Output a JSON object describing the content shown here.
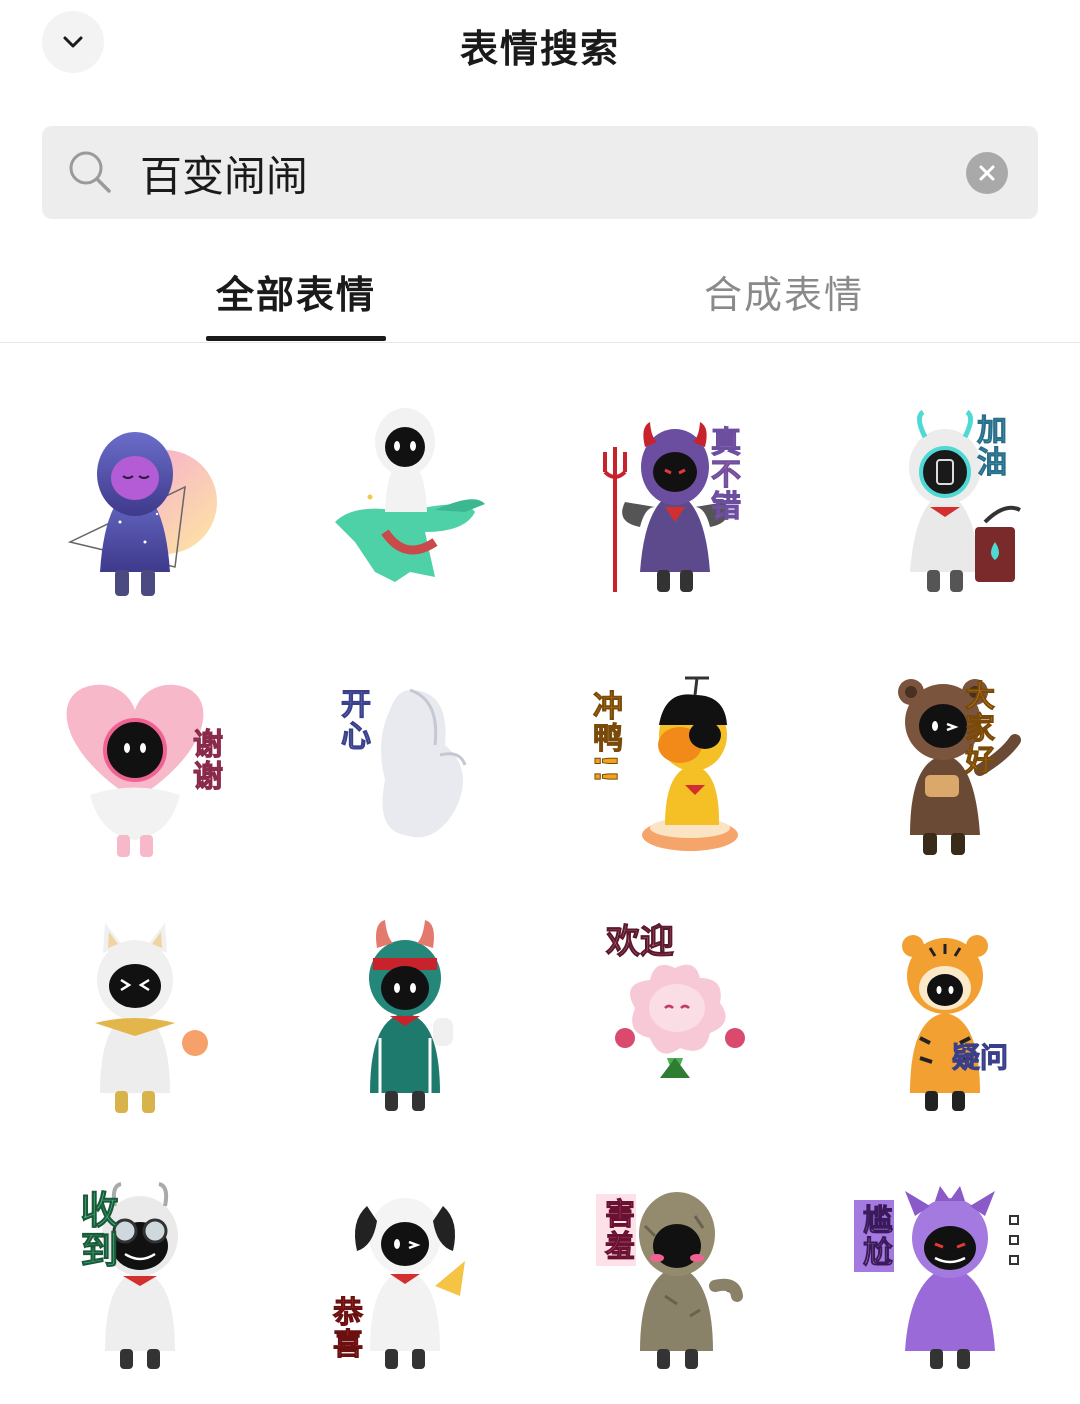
{
  "header": {
    "title": "表情搜索",
    "back_icon": "chevron-down-icon"
  },
  "search": {
    "value": "百变闹闹",
    "search_icon": "search-icon",
    "clear_icon": "close-icon"
  },
  "tabs": [
    {
      "label": "全部表情",
      "active": true
    },
    {
      "label": "合成表情",
      "active": false
    }
  ],
  "stickers": [
    {
      "caption": "",
      "theme": "galaxy"
    },
    {
      "caption": "",
      "theme": "crocodile"
    },
    {
      "caption": "真不错",
      "theme": "devil"
    },
    {
      "caption": "加油",
      "theme": "robot"
    },
    {
      "caption": "谢谢",
      "theme": "heart"
    },
    {
      "caption": "开心",
      "theme": "white-blob"
    },
    {
      "caption": "冲鸭!!",
      "theme": "duck"
    },
    {
      "caption": "大家好",
      "theme": "bear"
    },
    {
      "caption": "",
      "theme": "cat"
    },
    {
      "caption": "",
      "theme": "tracksuit"
    },
    {
      "caption": "欢迎",
      "theme": "flower"
    },
    {
      "caption": "疑问",
      "theme": "tiger"
    },
    {
      "caption": "收到",
      "theme": "goggles"
    },
    {
      "caption": "恭喜",
      "theme": "dog"
    },
    {
      "caption": "害羞",
      "theme": "rock"
    },
    {
      "caption": "尴尬",
      "theme": "purple-ghost"
    }
  ],
  "colors": {
    "accent": "#1a1a1a",
    "inactive_tab": "#8a8a8a",
    "search_bg": "#ededed"
  }
}
